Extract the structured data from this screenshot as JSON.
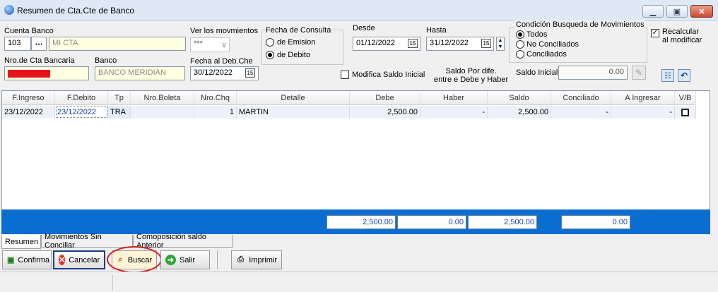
{
  "window": {
    "title": "Resumen de Cta.Cte de Banco"
  },
  "form": {
    "cuenta_banco_label": "Cuenta Banco",
    "cuenta_code": "103",
    "cuenta_name": "MI CTA",
    "nro_cta_label": "Nro.de Cta Bancaria",
    "banco_label": "Banco",
    "banco_value": "BANCO MERIDIAN",
    "ver_mov_label": "Ver los movmientos",
    "ver_mov_value": "***",
    "fecha_deb_che_label": "Fecha al Deb.Che",
    "fecha_deb_che_value": "30/12/2022",
    "fecha_consulta_label": "Fecha de Consulta",
    "fecha_opt_emision": "de Emision",
    "fecha_opt_debito": "de Debito",
    "desde_label": "Desde",
    "desde_value": "01/12/2022",
    "hasta_label": "Hasta",
    "hasta_value": "31/12/2022",
    "modifica_saldo_label": "Modifica Saldo Inicial",
    "saldo_dife_line1": "Saldo Por dife.",
    "saldo_dife_line2": "entre e Debe y Haber",
    "saldo_inicial_label": "Saldo Inicial",
    "saldo_inicial_value": "0.00",
    "condicion_label": "Condición Busqueda de Movimientos",
    "cond_todos": "Todos",
    "cond_no_conciliados": "No Conciliados",
    "cond_conciliados": "Conciliados",
    "recalcular_line1": "Recalcular",
    "recalcular_line2": "al modificar"
  },
  "grid": {
    "headers": [
      "F.Ingreso",
      "F.Debito",
      "Tp",
      "Nro.Boleta",
      "Nro.Chq",
      "Detalle",
      "Debe",
      "Haber",
      "Saldo",
      "Conciliado",
      "A Ingresar",
      "V/B"
    ],
    "row": {
      "f_ingreso": "23/12/2022",
      "f_debito": "23/12/2022",
      "tp": "TRA",
      "nro_boleta": "",
      "nro_chq": "1",
      "detalle": "MARTIN",
      "debe": "2,500.00",
      "haber": "-",
      "saldo": "2,500.00",
      "conciliado": "-",
      "a_ingresar": "-"
    }
  },
  "totals": {
    "debe": "2,500.00",
    "haber": "0.00",
    "saldo": "2,500.00",
    "a_ingresar": "0.00"
  },
  "tabs": [
    "Resumen",
    "Movimientos Sin Conciliar",
    "Comoposición saldo Anterior"
  ],
  "buttons": {
    "confirma": "Confirma",
    "cancelar": "Cancelar",
    "buscar": "Buscar",
    "salir": "Salir",
    "imprimir": "Imprimir"
  },
  "colors": {
    "highlight_ring": "#d81e1e",
    "totals_bar": "#0b6dd0",
    "redacted": "#e8141c"
  }
}
